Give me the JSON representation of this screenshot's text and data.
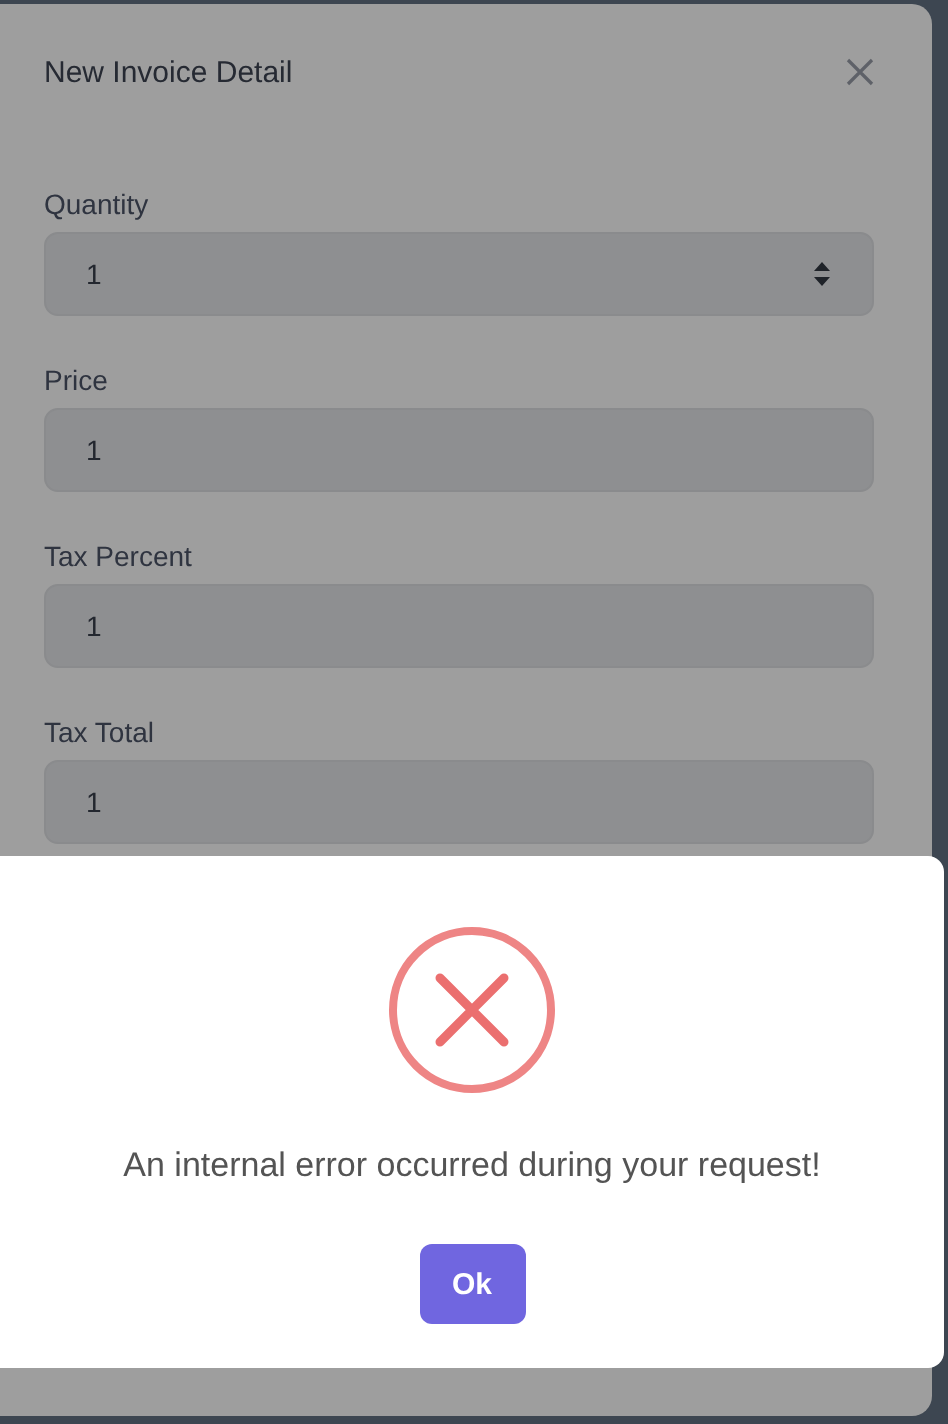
{
  "dialog": {
    "title": "New Invoice Detail",
    "fields": [
      {
        "label": "Quantity",
        "value": "1",
        "kind": "number"
      },
      {
        "label": "Price",
        "value": "1",
        "kind": "text"
      },
      {
        "label": "Tax Percent",
        "value": "1",
        "kind": "text"
      },
      {
        "label": "Tax Total",
        "value": "1",
        "kind": "text"
      }
    ]
  },
  "alert": {
    "kind": "error",
    "message": "An internal error occurred during your request!",
    "confirm_button": "Ok"
  }
}
